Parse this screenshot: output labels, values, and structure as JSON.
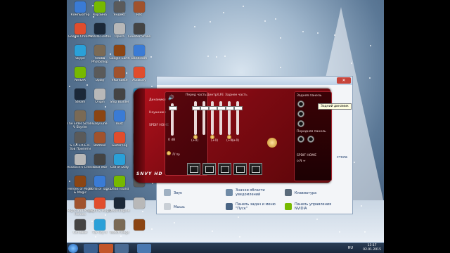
{
  "desktop": {
    "icons_col1": [
      "Компьютер",
      "Google Chrome",
      "Skype",
      "NVIDIA",
      "Steam",
      "The Elder Scrolls V Skyrim",
      "S.T.A.L.K.E.R. Зов Припяти",
      "Assassin's Creed",
      "Heroes of Might & Magic",
      "Might and Magic Heroes",
      "Сетевой"
    ],
    "icons_col2": [
      "Корзина",
      "Mozilla Firefox",
      "Adobe Photoshop",
      "Uplay",
      "Origin",
      "EasyTune",
      "Batman",
      "Total War",
      "World of Tanks",
      "Might & Magic",
      "Far Cry 4"
    ],
    "icons_col3": [
      "Яндекс",
      "Opera",
      "Google Earth",
      "VKontakte",
      "Ship Builder",
      "Rust",
      "Guitar Rig",
      "Call of Duty",
      "Dead Island",
      "Dead Engine",
      "Watch Dogs"
    ],
    "icons_col4": [
      "Rec",
      "Counter Strike",
      "Bandicam",
      "Audacity",
      "",
      "",
      "",
      "",
      "",
      "",
      ""
    ]
  },
  "taskbar": {
    "lang": "RU",
    "time": "13:17",
    "date": "02.01.2015"
  },
  "control_panel": {
    "title": "",
    "items": [
      {
        "label": "Звук"
      },
      {
        "label": "Значки области уведомлений"
      },
      {
        "label": "Клавиатура"
      },
      {
        "label": "Мышь"
      },
      {
        "label": "Панель задач и меню \"Пуск\""
      },
      {
        "label": "Панель управления NVIDIA"
      }
    ],
    "right_fragment": "стола",
    "left_fragment": "данных"
  },
  "hd_audio": {
    "left_labels": [
      "Динамики",
      "Наушники",
      "SPDIF HOME"
    ],
    "volume_label": "0 dB",
    "balance_label": "Л/ пр",
    "group_labels": [
      "Перед часть",
      "Центр/LFE",
      "Заднее часть"
    ],
    "slider_levels": [
      0.85,
      0.85,
      0.85,
      0.85,
      0.85,
      0.85
    ],
    "slider_values": [
      "(+0)",
      "(+0)",
      "(+0)",
      "(+0)"
    ],
    "right_top_label": "Задняя панель",
    "right_mid_label": "Передняя панель",
    "right_bottom_label": "SPDIF HOME",
    "spdif_value": "o.N ≈",
    "tooltip": "Задний динамик",
    "brand": "SNVY HD",
    "accent": "#b3111c"
  }
}
